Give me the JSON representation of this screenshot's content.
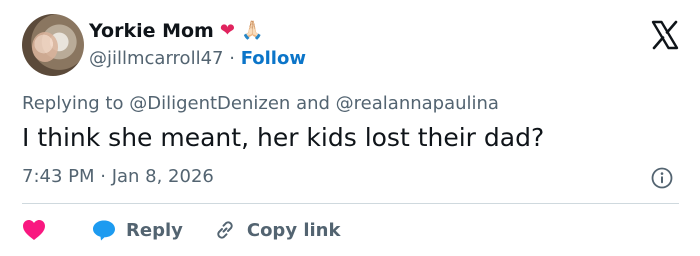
{
  "author": {
    "name": "Yorkie Mom",
    "name_emojis": [
      "❤",
      "🙏🏻"
    ],
    "handle": "@jillmcarroll47",
    "separator": "·",
    "follow_label": "Follow"
  },
  "reply_context": {
    "prefix": "Replying to",
    "mention_1": "@DiligentDenizen",
    "joiner": "and",
    "mention_2": "@realannapaulina"
  },
  "tweet": {
    "text": "I think she meant, her kids lost their dad?",
    "timestamp": "7:43 PM · Jan 8, 2026"
  },
  "actions": {
    "reply_label": "Reply",
    "copy_link_label": "Copy link"
  },
  "colors": {
    "heart": "#f91880",
    "reply_bubble": "#1d9bf0",
    "link_blue": "#0b75c9",
    "muted_text": "#536471"
  },
  "icons": {
    "logo": "x-logo-icon",
    "info": "info-icon",
    "like": "heart-icon",
    "reply": "speech-bubble-icon",
    "copy": "link-icon"
  }
}
